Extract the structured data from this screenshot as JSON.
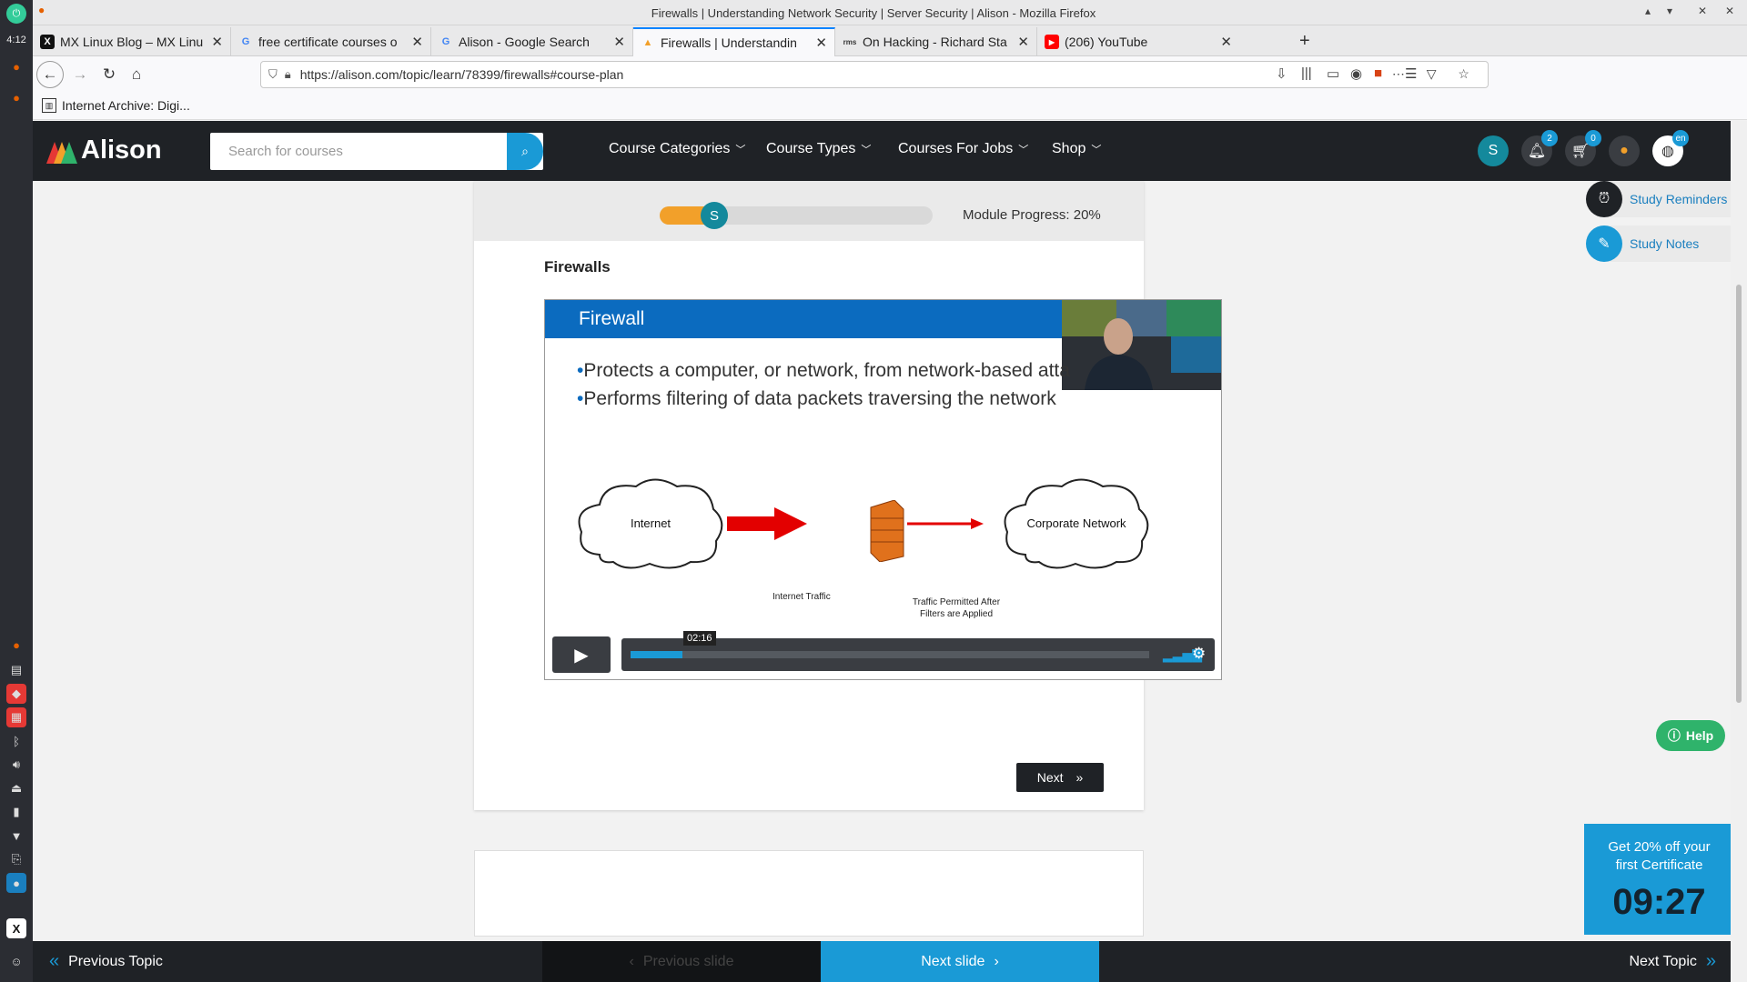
{
  "window": {
    "title": "Firewalls | Understanding Network Security | Server Security | Alison - Mozilla Firefox",
    "controls": [
      "▴",
      "▾",
      "✕",
      "✕"
    ]
  },
  "desktop_panel": {
    "clock": "4:12"
  },
  "tabs": [
    {
      "label": "MX Linux Blog – MX Linu",
      "favicon": "X",
      "icon": "mx-linux-favicon"
    },
    {
      "label": "free certificate courses o",
      "favicon": "G",
      "icon": "google-favicon"
    },
    {
      "label": "Alison - Google Search",
      "favicon": "G",
      "icon": "google-favicon"
    },
    {
      "label": "Firewalls | Understandin",
      "favicon": "▲",
      "icon": "alison-favicon",
      "active": true
    },
    {
      "label": "On Hacking - Richard Sta",
      "favicon": "rms",
      "icon": "stallman-favicon"
    },
    {
      "label": "(206) YouTube",
      "favicon": "▶",
      "icon": "youtube-favicon"
    }
  ],
  "nav": {
    "url": "https://alison.com/topic/learn/78399/firewalls#course-plan"
  },
  "bookmarks": [
    {
      "label": "Internet Archive: Digi..."
    }
  ],
  "site": {
    "brand": "Alison",
    "search_placeholder": "Search for courses",
    "menu": [
      {
        "label": "Course Categories"
      },
      {
        "label": "Course Types"
      },
      {
        "label": "Courses For Jobs"
      },
      {
        "label": "Shop"
      }
    ],
    "user_initial": "S",
    "notifications_count": "2",
    "cart_count": "0",
    "language": "en"
  },
  "module": {
    "progress_label": "Module Progress: 20%",
    "progress_fraction": 0.2,
    "user_initial": "S",
    "title": "Firewalls"
  },
  "video": {
    "slide_title": "Firewall",
    "bullets": [
      "Protects a computer, or network, from network-based atta",
      "Performs filtering of data packets traversing the network"
    ],
    "diagram": {
      "left_cloud": "Internet",
      "right_cloud": "Corporate Network",
      "arrow1_label": "Internet Traffic",
      "arrow2_label_line1": "Traffic Permitted After",
      "arrow2_label_line2": "Filters are Applied"
    },
    "time": "02:16",
    "played_fraction": 0.1
  },
  "buttons": {
    "next": "Next",
    "prev_topic": "Previous Topic",
    "prev_slide": "Previous slide",
    "next_slide": "Next slide",
    "next_topic": "Next Topic",
    "help": "Help"
  },
  "side_tools": {
    "reminders": "Study Reminders",
    "notes": "Study Notes"
  },
  "promo": {
    "line1": "Get 20% off your",
    "line2": "first Certificate",
    "timer": "09:27"
  },
  "colors": {
    "accent": "#1a9ad6",
    "dark": "#1f2226",
    "progress": "#f2a02a",
    "teal": "#14899c",
    "help": "#2fb36b"
  }
}
